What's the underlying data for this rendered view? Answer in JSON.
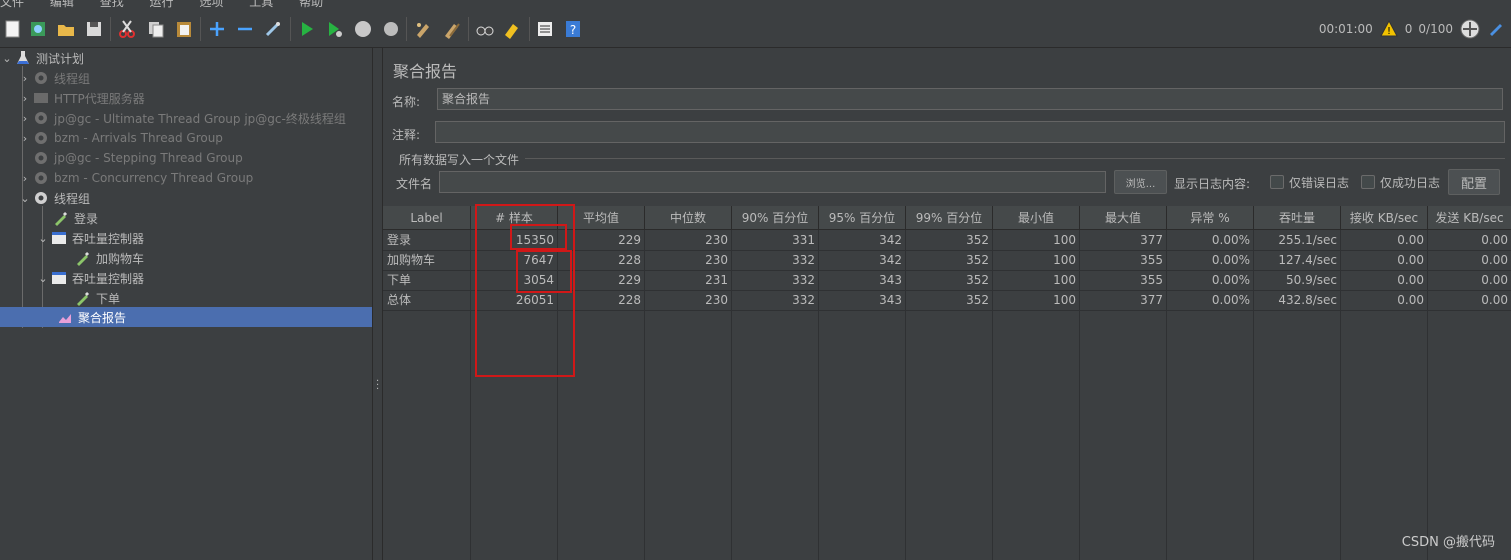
{
  "menu": [
    "文件",
    "编辑",
    "查找",
    "运行",
    "选项",
    "工具",
    "帮助"
  ],
  "toolbar": {
    "icons": [
      "new-icon",
      "templates-icon",
      "open-icon",
      "save-icon",
      "cut-icon",
      "copy-icon",
      "paste-icon",
      "expand-icon",
      "collapse-icon",
      "toggle-icon",
      "start-icon",
      "start-no-pauses-icon",
      "stop-icon",
      "shutdown-icon",
      "clear-icon",
      "clear-all-icon",
      "search-icon",
      "reset-search-icon",
      "function-helper-icon",
      "help-icon"
    ],
    "timer": "00:01:00",
    "warning_count": "0",
    "threads": "0/100"
  },
  "tree": {
    "items": [
      {
        "label": "测试计划",
        "level": 0,
        "expanded": true,
        "icon": "flask-icon",
        "enabled": true
      },
      {
        "label": "线程组",
        "level": 1,
        "expanded": false,
        "icon": "gear-icon",
        "enabled": false
      },
      {
        "label": "HTTP代理服务器",
        "level": 1,
        "expanded": false,
        "icon": "proxy-icon",
        "enabled": false
      },
      {
        "label": "jp@gc - Ultimate Thread Group   jp@gc-终极线程组",
        "level": 1,
        "expanded": false,
        "icon": "gear-icon",
        "enabled": false
      },
      {
        "label": "bzm - Arrivals Thread Group",
        "level": 1,
        "expanded": false,
        "icon": "gear-icon",
        "enabled": false
      },
      {
        "label": "jp@gc - Stepping Thread Group",
        "level": 1,
        "expanded": null,
        "icon": "gear-icon",
        "enabled": false
      },
      {
        "label": "bzm - Concurrency Thread Group",
        "level": 1,
        "expanded": false,
        "icon": "gear-icon",
        "enabled": false
      },
      {
        "label": "线程组",
        "level": 1,
        "expanded": true,
        "icon": "gear-icon",
        "enabled": true
      },
      {
        "label": "登录",
        "level": 2,
        "expanded": null,
        "icon": "pipette-icon",
        "enabled": true
      },
      {
        "label": "吞吐量控制器",
        "level": 2,
        "expanded": true,
        "icon": "controller-icon",
        "enabled": true
      },
      {
        "label": "加购物车",
        "level": 3,
        "expanded": null,
        "icon": "pipette-icon",
        "enabled": true
      },
      {
        "label": "吞吐量控制器",
        "level": 2,
        "expanded": true,
        "icon": "controller-icon",
        "enabled": true
      },
      {
        "label": "下单",
        "level": 3,
        "expanded": null,
        "icon": "pipette-icon",
        "enabled": true
      },
      {
        "label": "聚合报告",
        "level": 2,
        "expanded": null,
        "icon": "report-icon",
        "enabled": true,
        "selected": true
      }
    ]
  },
  "panel": {
    "title": "聚合报告",
    "name_label": "名称:",
    "name_value": "聚合报告",
    "comment_label": "注释:",
    "comment_value": "",
    "fieldset_title": "所有数据写入一个文件",
    "filename_label": "文件名",
    "filename_value": "",
    "browse_button": "浏览...",
    "log_label": "显示日志内容:",
    "errors_only": "仅错误日志",
    "success_only": "仅成功日志",
    "config_button": "配置"
  },
  "table": {
    "headers": [
      "Label",
      "# 样本",
      "平均值",
      "中位数",
      "90% 百分位",
      "95% 百分位",
      "99% 百分位",
      "最小值",
      "最大值",
      "异常 %",
      "吞吐量",
      "接收 KB/sec",
      "发送 KB/sec"
    ],
    "rows": [
      [
        "登录",
        "15350",
        "229",
        "230",
        "331",
        "342",
        "352",
        "100",
        "377",
        "0.00%",
        "255.1/sec",
        "0.00",
        "0.00"
      ],
      [
        "加购物车",
        "7647",
        "228",
        "230",
        "332",
        "342",
        "352",
        "100",
        "355",
        "0.00%",
        "127.4/sec",
        "0.00",
        "0.00"
      ],
      [
        "下单",
        "3054",
        "229",
        "231",
        "332",
        "343",
        "352",
        "100",
        "355",
        "0.00%",
        "50.9/sec",
        "0.00",
        "0.00"
      ],
      [
        "总体",
        "26051",
        "228",
        "230",
        "332",
        "343",
        "352",
        "100",
        "377",
        "0.00%",
        "432.8/sec",
        "0.00",
        "0.00"
      ]
    ]
  },
  "watermark": "CSDN @搬代码",
  "colors": {
    "background": "#3c3f41",
    "selection": "#4b6eaf",
    "annotation": "#d01818"
  }
}
